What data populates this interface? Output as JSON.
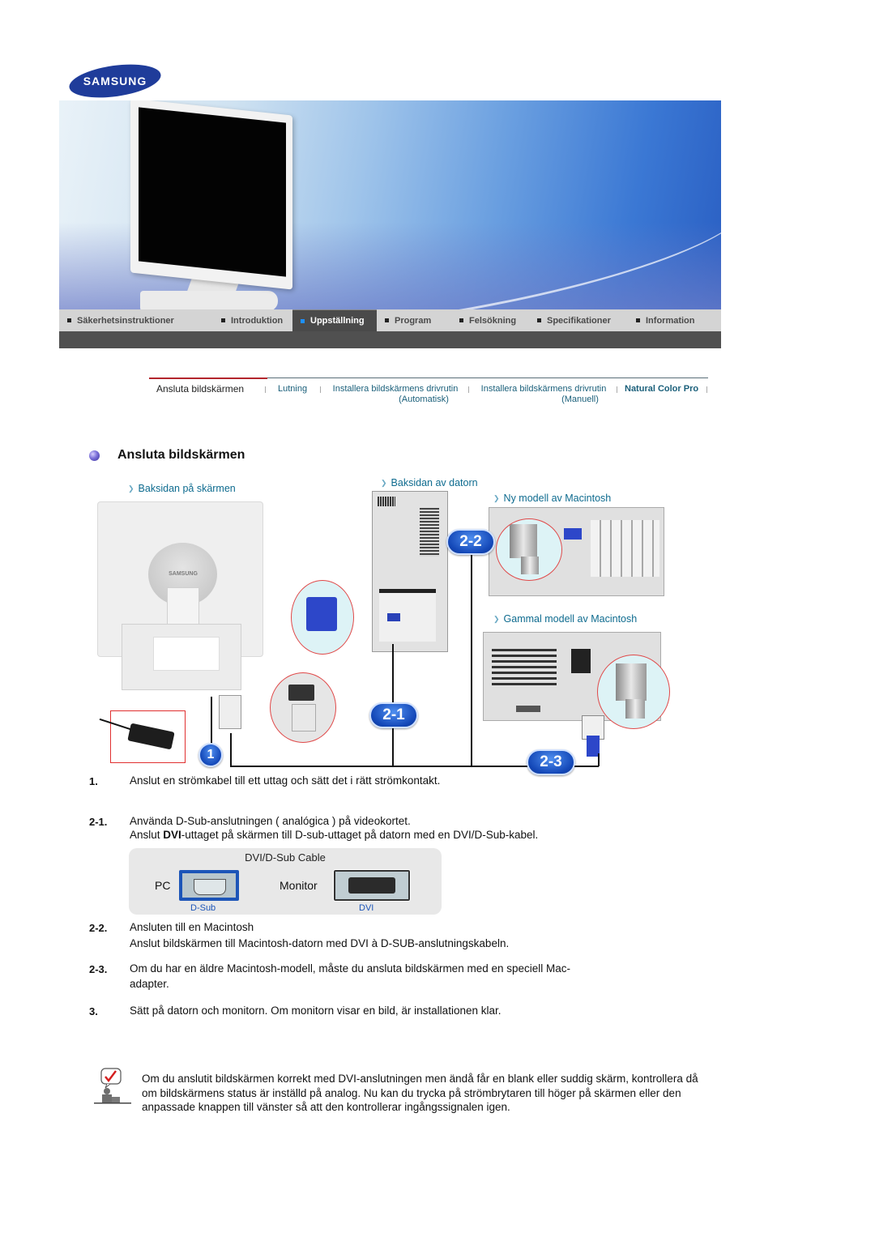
{
  "brand": {
    "logo_text": "SAMSUNG",
    "colors": {
      "logo_blue": "#1f3c9a",
      "active_nav": "#4a4a4a",
      "active_nav_marker": "#1e90ff",
      "subnav_text": "#1a5f7a",
      "subnav_active_underline": "#b3262d",
      "diagram_label": "#0e6b8f",
      "badge_blue": "#1448b8"
    }
  },
  "main_nav": {
    "items": [
      {
        "label": "Säkerhetsinstruktioner",
        "active": false
      },
      {
        "label": "Introduktion",
        "active": false
      },
      {
        "label": "Uppställning",
        "active": true
      },
      {
        "label": "Program",
        "active": false
      },
      {
        "label": "Felsökning",
        "active": false
      },
      {
        "label": "Specifikationer",
        "active": false
      },
      {
        "label": "Information",
        "active": false
      }
    ]
  },
  "sub_nav": {
    "items": [
      {
        "label": "Ansluta bildskärmen",
        "sub": "",
        "active": true
      },
      {
        "label": "Lutning",
        "sub": "",
        "active": false
      },
      {
        "label": "Installera bildskärmens drivrutin",
        "sub": "(Automatisk)",
        "active": false
      },
      {
        "label": "Installera bildskärmens drivrutin",
        "sub": "(Manuell)",
        "active": false
      },
      {
        "label": "Natural Color Pro",
        "sub": "",
        "active": false
      }
    ]
  },
  "section": {
    "title": "Ansluta bildskärmen"
  },
  "diagram": {
    "labels": {
      "monitor_back": "Baksidan på skärmen",
      "computer_back": "Baksidan av datorn",
      "new_mac": "Ny modell av Macintosh",
      "old_mac": "Gammal modell av Macintosh"
    },
    "badges": [
      "1",
      "2-1",
      "2-2",
      "2-3"
    ],
    "monitor_logo": "SAMSUNG"
  },
  "steps": [
    {
      "num": "1.",
      "lines": [
        "Anslut en strömkabel till ett uttag och sätt det i rätt strömkontakt."
      ]
    },
    {
      "num": "2-1.",
      "lines": [
        "Använda D-Sub-anslutningen ( analógica ) på videokortet."
      ],
      "line2_pre": "Anslut ",
      "line2_bold": "DVI",
      "line2_post": "-uttaget på skärmen till D-sub-uttaget på datorn med en DVI/D-Sub-kabel."
    },
    {
      "num": "2-2.",
      "lines": [
        "Ansluten till en Macintosh",
        "Anslut bildskärmen till Macintosh-datorn med DVI à D-SUB-anslutningskabeln."
      ]
    },
    {
      "num": "2-3.",
      "lines": [
        "Om du har en äldre Macintosh-modell, måste du ansluta bildskärmen med en speciell Mac-",
        "adapter."
      ]
    },
    {
      "num": "3.",
      "lines": [
        "Sätt på datorn och monitorn. Om monitorn visar en bild, är installationen klar."
      ]
    }
  ],
  "cable_figure": {
    "title": "DVI/D-Sub Cable",
    "pc_label": "PC",
    "monitor_label": "Monitor",
    "dsub_label": "D-Sub",
    "dvi_label": "DVI"
  },
  "note": {
    "icon": "checkmark-note-icon",
    "text": "Om du anslutit bildskärmen korrekt med DVI-anslutningen men ändå får en blank eller suddig skärm, kontrollera då om bildskärmens status är inställd på analog. Nu kan du trycka på strömbrytaren till höger på skärmen eller den anpassade knappen till vänster så att den kontrollerar ingångssignalen igen."
  }
}
